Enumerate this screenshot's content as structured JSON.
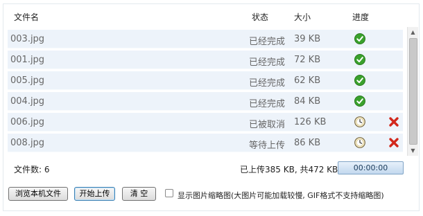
{
  "columns": {
    "name": "文件名",
    "status": "状态",
    "size": "大小",
    "progress": "进度"
  },
  "files": [
    {
      "name": "003.jpg",
      "status": "已经完成",
      "size": "39 KB",
      "progress_icon": "check-icon",
      "removable": false
    },
    {
      "name": "001.jpg",
      "status": "已经完成",
      "size": "72 KB",
      "progress_icon": "check-icon",
      "removable": false
    },
    {
      "name": "005.jpg",
      "status": "已经完成",
      "size": "62 KB",
      "progress_icon": "check-icon",
      "removable": false
    },
    {
      "name": "004.jpg",
      "status": "已经完成",
      "size": "84 KB",
      "progress_icon": "check-icon",
      "removable": false
    },
    {
      "name": "006.jpg",
      "status": "已被取消",
      "size": "126 KB",
      "progress_icon": "clock-icon",
      "removable": true
    },
    {
      "name": "008.jpg",
      "status": "等待上传",
      "size": "86 KB",
      "progress_icon": "clock-icon",
      "removable": true
    }
  ],
  "footer": {
    "file_count": "文件数: 6",
    "upload_stats": "已上传385 KB, 共472 KB",
    "timer": "00:00:00"
  },
  "buttons": {
    "browse": "浏览本机文件",
    "upload": "开始上传",
    "clear": "清 空"
  },
  "thumbnail_option": {
    "label": "显示图片缩略图(大图片可能加载较慢, GIF格式不支持缩略图)",
    "checked": false
  },
  "colors": {
    "row_bg": "#edf3fa",
    "check": "#3aa12c",
    "delete": "#d2281c",
    "timer_border": "#7fa3c6"
  }
}
